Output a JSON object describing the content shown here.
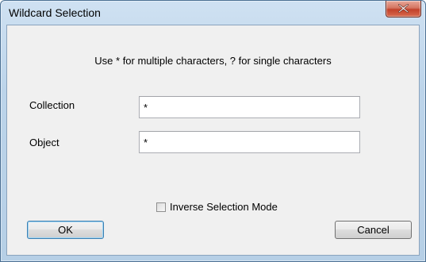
{
  "window": {
    "title": "Wildcard Selection"
  },
  "dialog": {
    "hint": "Use * for multiple characters, ? for single characters",
    "fields": [
      {
        "label": "Collection",
        "value": "*"
      },
      {
        "label": "Object",
        "value": "*"
      }
    ],
    "inverse_selection": {
      "label": "Inverse Selection Mode",
      "checked": false
    },
    "ok_label": "OK",
    "cancel_label": "Cancel"
  },
  "icons": {
    "close": "close-icon"
  },
  "colors": {
    "title_bar": "#bcd4ea",
    "close_button": "#c2412a",
    "client_bg": "#f0f0f0"
  }
}
